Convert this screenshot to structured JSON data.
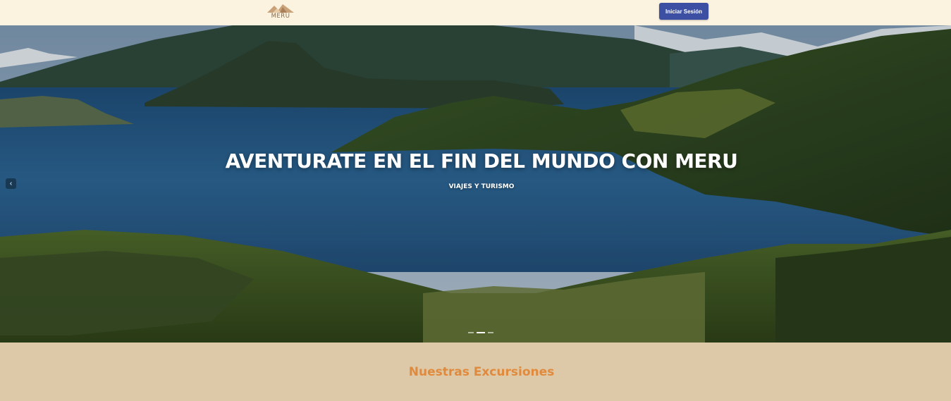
{
  "navbar": {
    "logo_text": "MERU",
    "login_button": "Iniciar Sesión"
  },
  "hero": {
    "title": "AVENTURATE EN EL FIN DEL MUNDO CON MERU",
    "subtitle": "VIAJES Y TURISMO",
    "prev_icon": "‹",
    "slides_count": 3,
    "active_slide": 2
  },
  "section": {
    "title": "Nuestras Excursiones"
  },
  "colors": {
    "navbar_bg": "#fbf3e0",
    "button_bg": "#3c4fa3",
    "section_bg": "#ddc9a7",
    "section_title": "#e08a3e"
  }
}
